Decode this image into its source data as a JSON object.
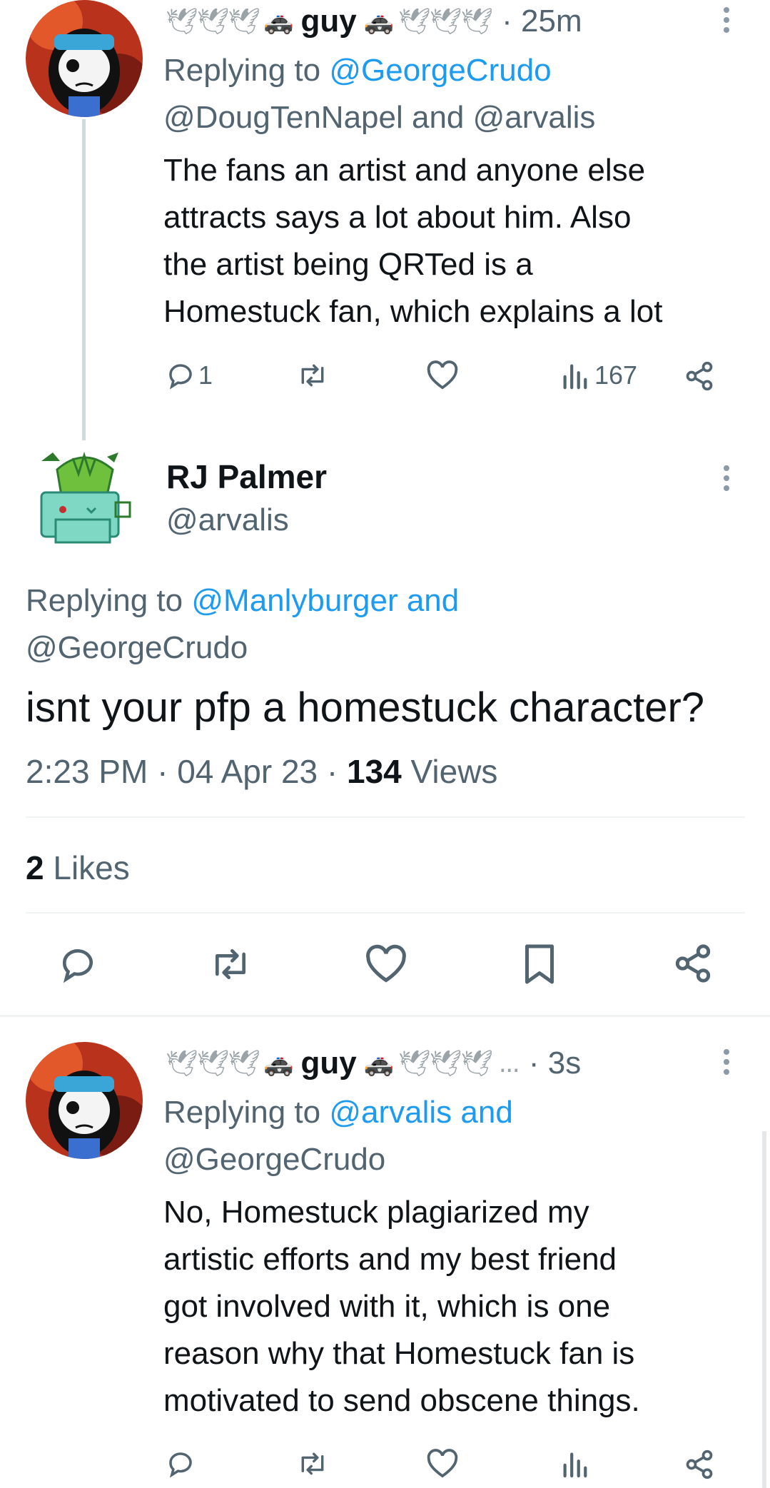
{
  "tweet1": {
    "name_prefix": "🕊🕊🕊",
    "name": "guy",
    "name_suffix": "🕊🕊🕊",
    "time": "· 25m",
    "replying_prefix": "Replying to",
    "replying_line1": "@GeorgeCrudo",
    "replying_line2": "@DougTenNapel and @arvalis",
    "body": [
      "The fans an artist and anyone else",
      "attracts says a lot about him. Also",
      "the artist being QRTed is a",
      "Homestuck fan, which explains a lot"
    ],
    "reply_count": "1",
    "views": "167"
  },
  "main_tweet": {
    "display_name": "RJ Palmer",
    "handle": "@arvalis",
    "replying_prefix": "Replying to",
    "replying_line1": "@Manlyburger and",
    "replying_line2": "@GeorgeCrudo",
    "body": "isnt your pfp a homestuck character?",
    "timestamp": "2:23 PM · 04 Apr 23 · ",
    "views_count": "134",
    "views_label": " Views",
    "likes_count": "2",
    "likes_label": " Likes"
  },
  "tweet3": {
    "name_prefix": "🕊🕊🕊",
    "name": "guy",
    "name_suffix": "🕊🕊🕊 ...",
    "time": "· 3s",
    "replying_prefix": "Replying to",
    "replying_line1": "@arvalis and",
    "replying_line2": "@GeorgeCrudo",
    "body": [
      "No, Homestuck plagiarized my",
      "artistic efforts and my best friend",
      "got involved with it, which is one",
      "reason why that Homestuck fan is",
      "motivated to send obscene things."
    ]
  },
  "colors": {
    "accent": "#1d9bf0",
    "secondary": "#536471",
    "divider": "#eff3f4"
  }
}
